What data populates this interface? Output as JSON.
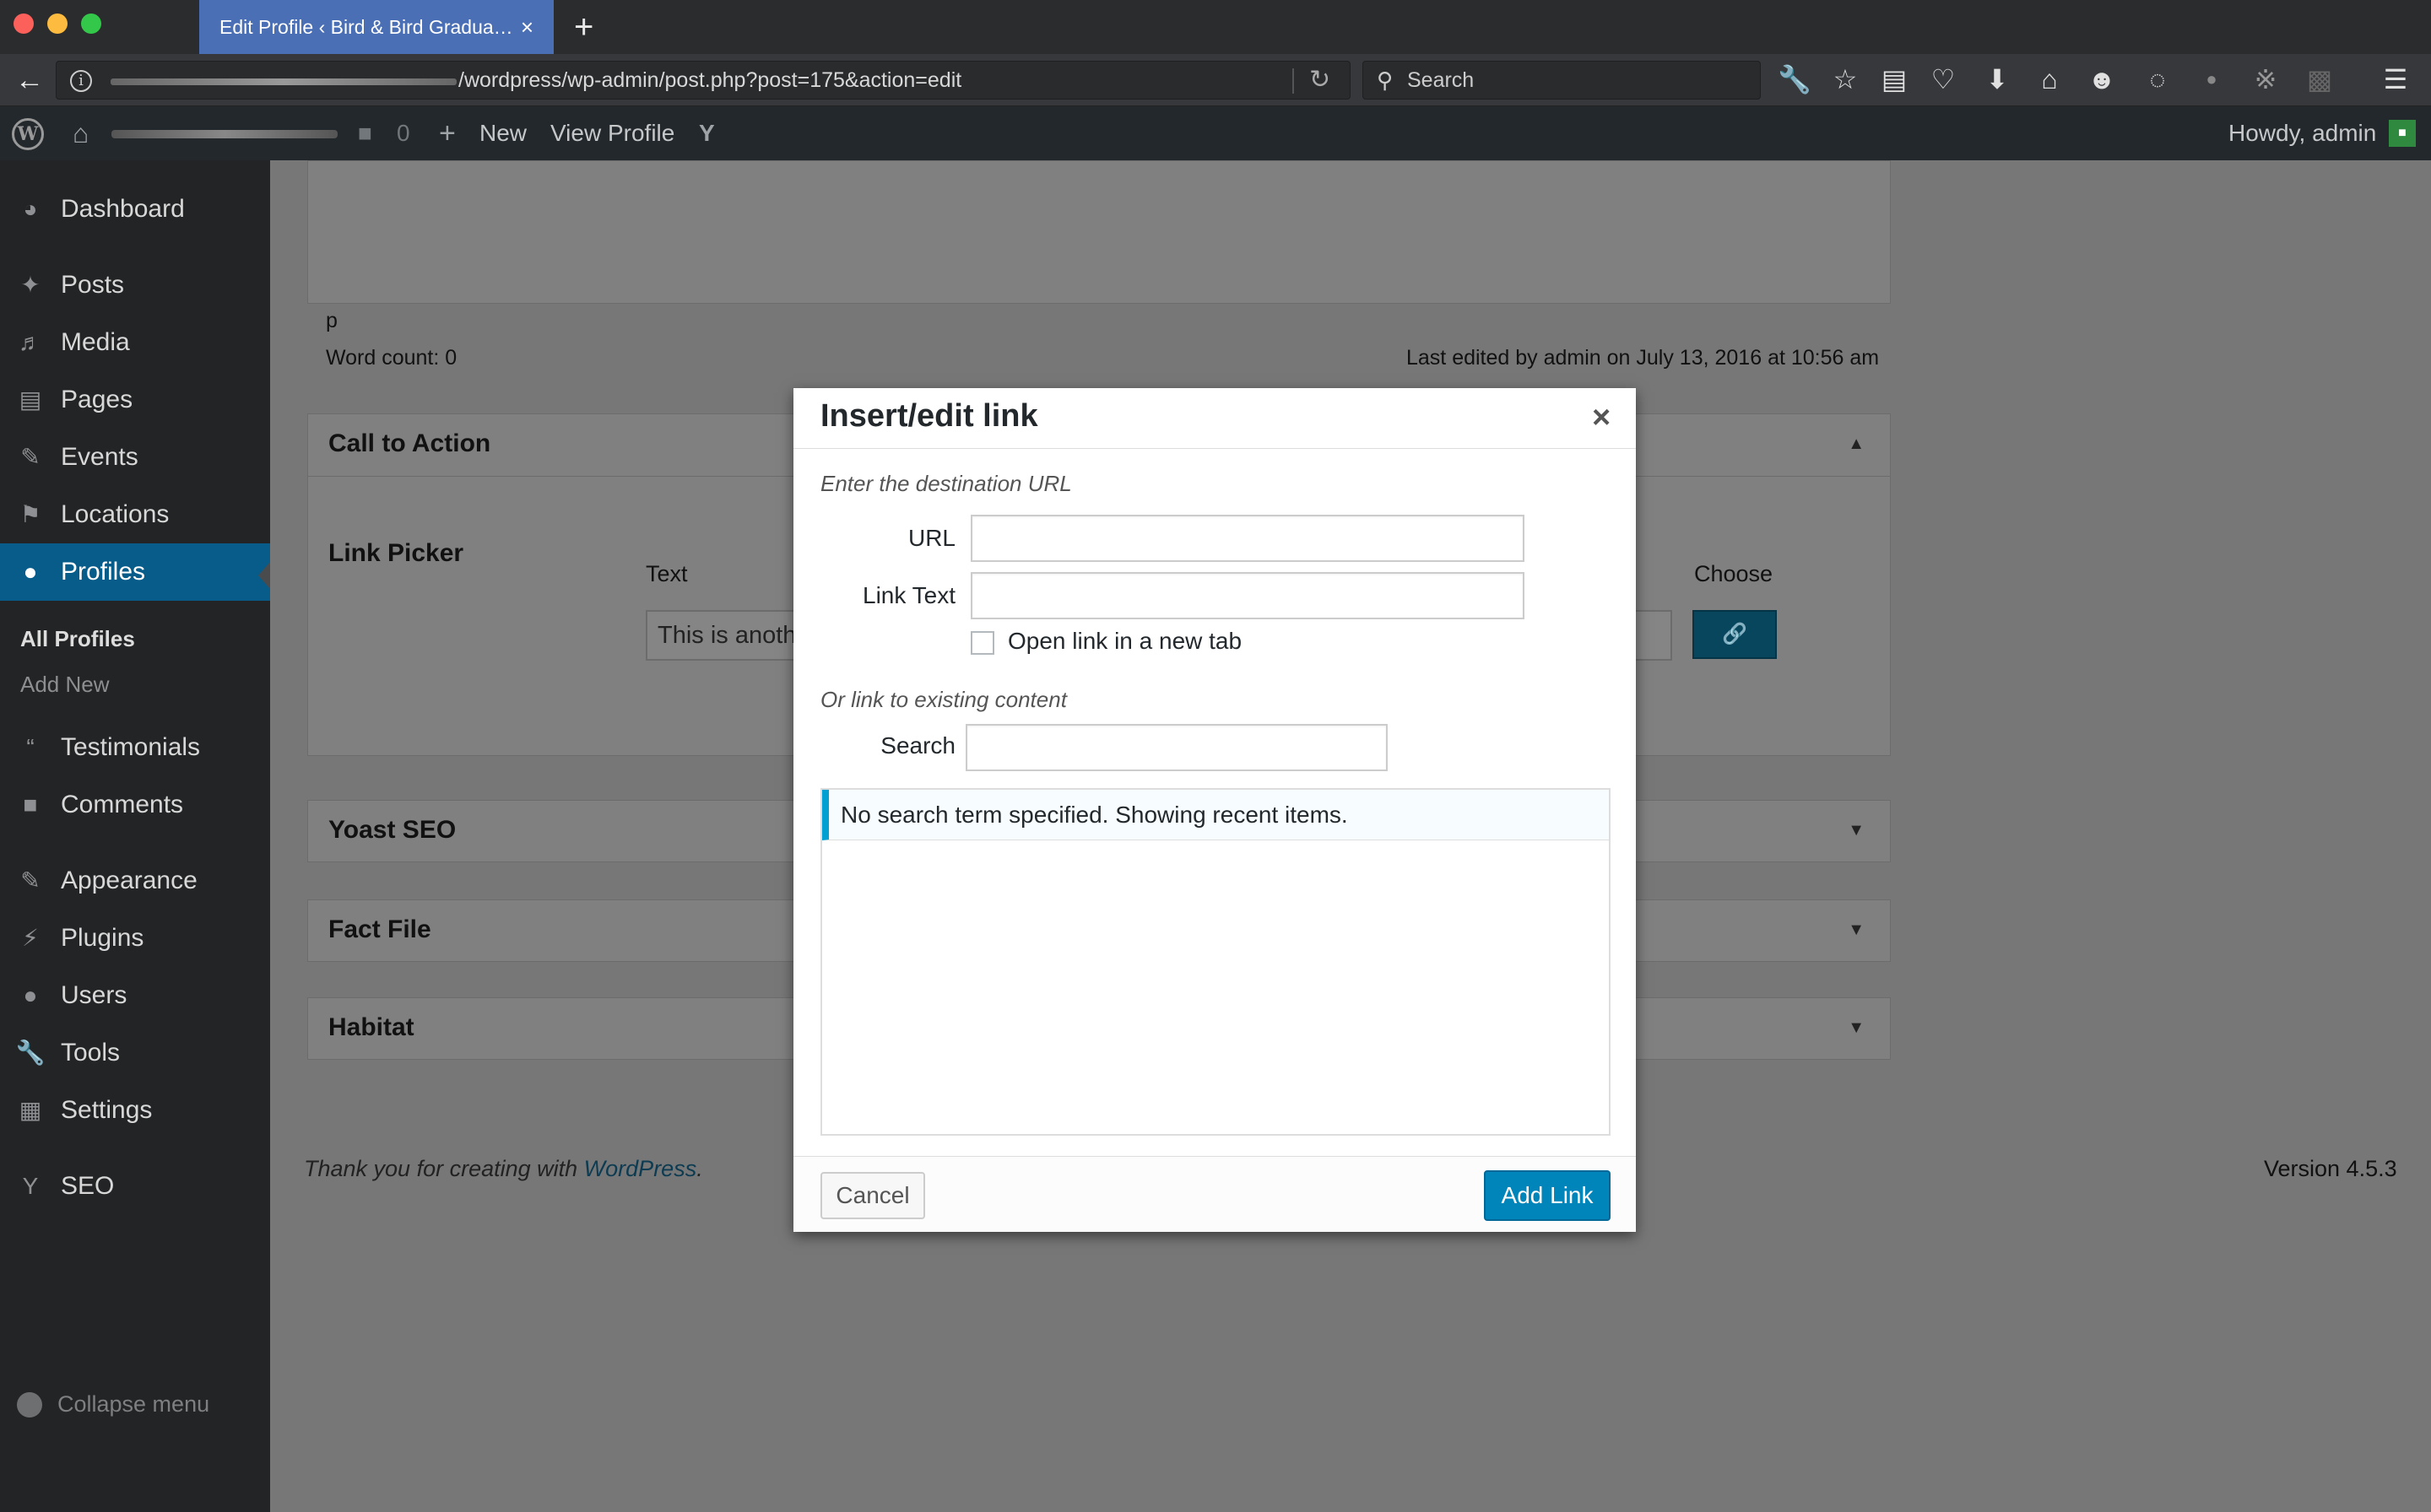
{
  "browser": {
    "tab_title": "Edit Profile ‹ Bird & Bird Gradua…",
    "tab_close": "×",
    "new_tab": "+",
    "url": "/wordpress/wp-admin/post.php?post=175&action=edit",
    "search_placeholder": "Search"
  },
  "adminbar": {
    "comments_count": "0",
    "new_label": "New",
    "view_profile_label": "View Profile",
    "howdy": "Howdy, admin"
  },
  "sidebar": {
    "items": [
      {
        "label": "Dashboard",
        "icon": "dashboard-icon"
      },
      {
        "label": "Posts",
        "icon": "pin-icon"
      },
      {
        "label": "Media",
        "icon": "media-icon"
      },
      {
        "label": "Pages",
        "icon": "pages-icon"
      },
      {
        "label": "Events",
        "icon": "events-icon"
      },
      {
        "label": "Locations",
        "icon": "locations-icon"
      },
      {
        "label": "Profiles",
        "icon": "user-icon"
      },
      {
        "label": "Testimonials",
        "icon": "quote-icon"
      },
      {
        "label": "Comments",
        "icon": "comment-icon"
      },
      {
        "label": "Appearance",
        "icon": "brush-icon"
      },
      {
        "label": "Plugins",
        "icon": "plugin-icon"
      },
      {
        "label": "Users",
        "icon": "users-icon"
      },
      {
        "label": "Tools",
        "icon": "wrench-icon"
      },
      {
        "label": "Settings",
        "icon": "settings-icon"
      },
      {
        "label": "SEO",
        "icon": "yoast-icon"
      }
    ],
    "submenu": [
      "All Profiles",
      "Add New"
    ],
    "collapse_label": "Collapse menu"
  },
  "editor": {
    "path_label": "p",
    "word_count": "Word count: 0",
    "last_edited": "Last edited by admin on July 13, 2016 at 10:56 am"
  },
  "panels": {
    "call_to_action": "Call to Action",
    "link_picker": "Link Picker",
    "text_col": "Text",
    "choose_col": "Choose",
    "text_value": "This is anoth",
    "yoast": "Yoast SEO",
    "fact_file": "Fact File",
    "habitat": "Habitat"
  },
  "footer": {
    "thanks_prefix": "Thank you for creating with ",
    "wordpress_link": "WordPress",
    "thanks_suffix": ".",
    "version": "Version 4.5.3"
  },
  "modal": {
    "title": "Insert/edit link",
    "close": "×",
    "dest_label": "Enter the destination URL",
    "url_label": "URL",
    "url_value": "",
    "link_text_label": "Link Text",
    "link_text_value": "",
    "new_tab_label": "Open link in a new tab",
    "new_tab_checked": false,
    "existing_label": "Or link to existing content",
    "search_label": "Search",
    "search_value": "",
    "notice": "No search term specified. Showing recent items.",
    "cancel": "Cancel",
    "add_link": "Add Link"
  },
  "colors": {
    "accent": "#0085ba",
    "notice_border": "#00a0d2",
    "admin_bar": "#23282d",
    "menu_active": "#085c8a"
  }
}
